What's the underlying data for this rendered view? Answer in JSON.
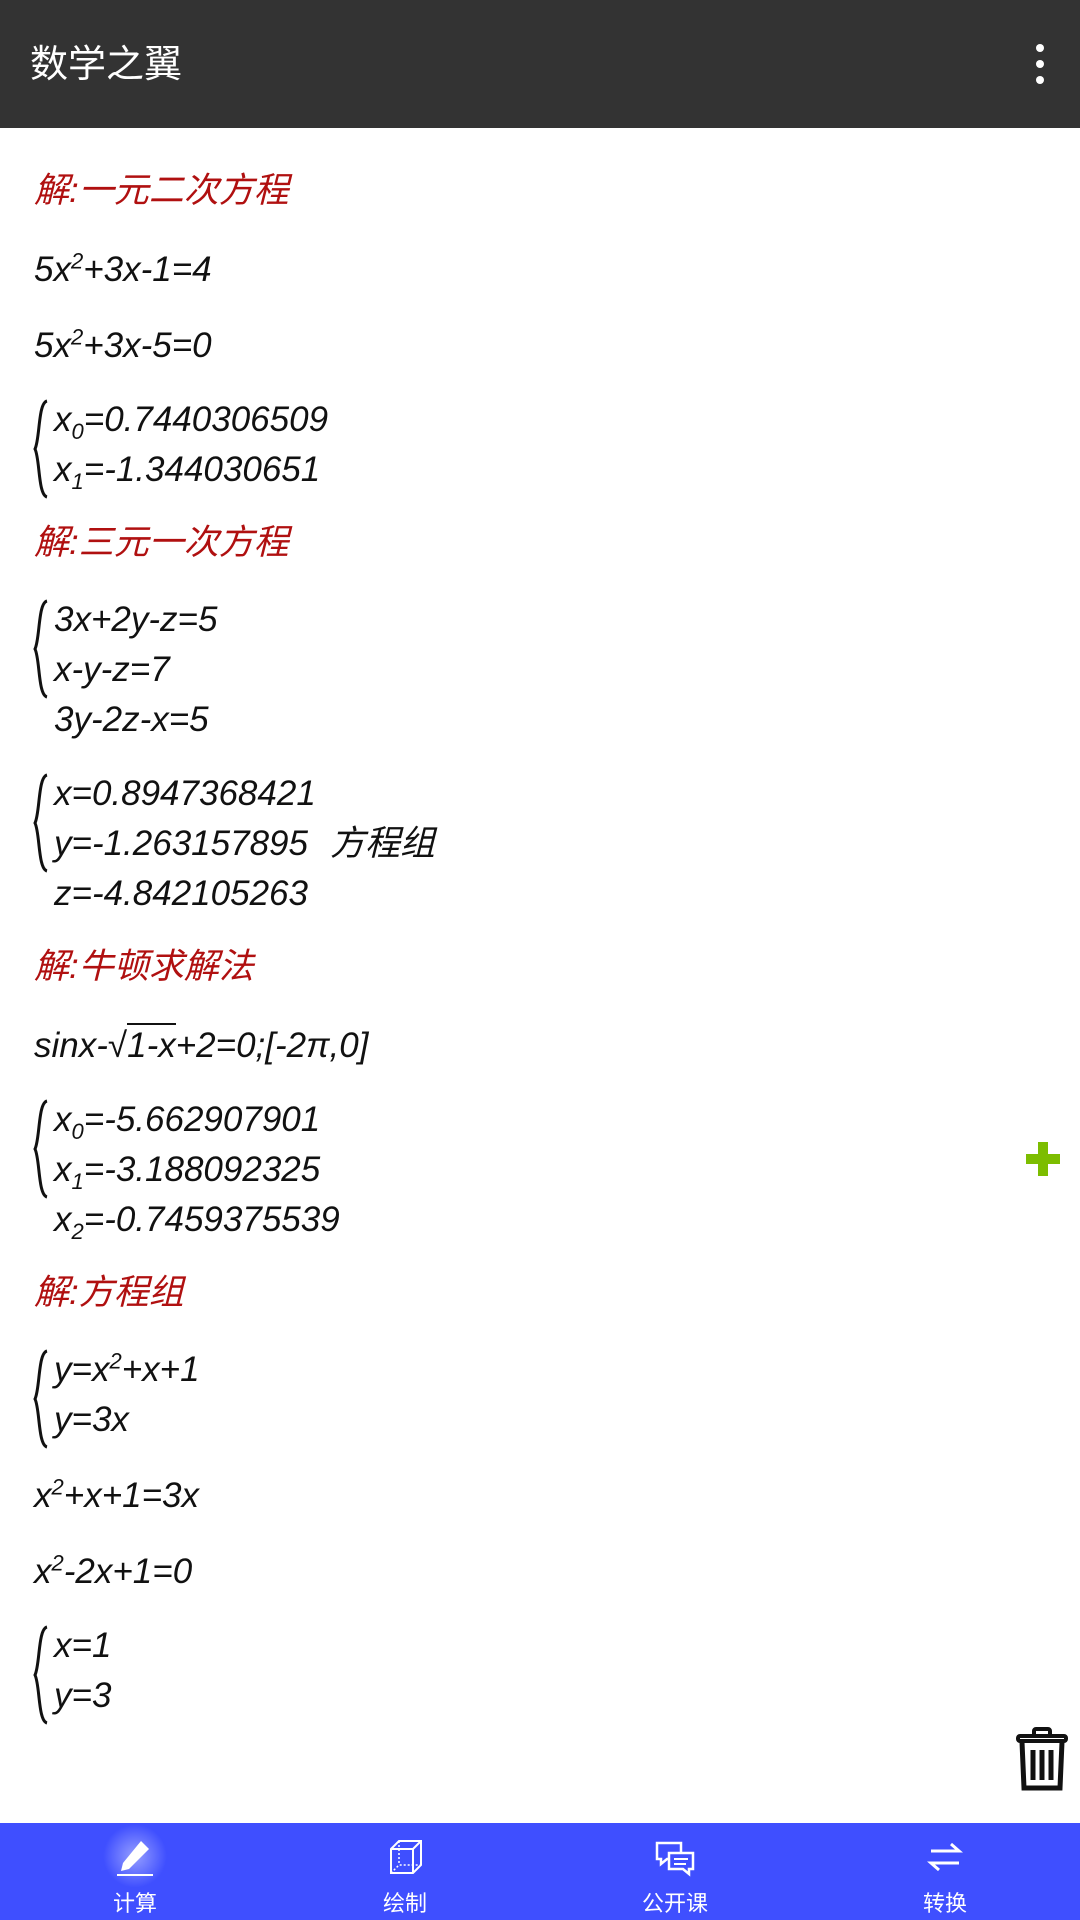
{
  "appbar": {
    "title": "数学之翼"
  },
  "sections": {
    "s1": {
      "title": "解:一元二次方程",
      "eq1": {
        "a": "5x",
        "exp": "2",
        "b": "+3x-1=4"
      },
      "eq2": {
        "a": "5x",
        "exp": "2",
        "b": "+3x-5=0"
      },
      "res": [
        {
          "v": "x",
          "sub": "0",
          "rest": "=0.7440306509"
        },
        {
          "v": "x",
          "sub": "1",
          "rest": "=-1.344030651"
        }
      ]
    },
    "s2": {
      "title": "解:三元一次方程",
      "sys": [
        "3x+2y-z=5",
        "x-y-z=7",
        "3y-2z-x=5"
      ],
      "res": [
        "x=0.8947368421",
        "y=-1.263157895",
        "z=-4.842105263"
      ],
      "note": "方程组"
    },
    "s3": {
      "title": "解:牛顿求解法",
      "eq": {
        "a": "sinx-√",
        "rad": "1-x",
        "b": "+2=0;[-2π,0]"
      },
      "res": [
        {
          "v": "x",
          "sub": "0",
          "rest": "=-5.662907901"
        },
        {
          "v": "x",
          "sub": "1",
          "rest": "=-3.188092325"
        },
        {
          "v": "x",
          "sub": "2",
          "rest": "=-0.7459375539"
        }
      ]
    },
    "s4": {
      "title": "解:方程组",
      "sys1": {
        "a": "y=x",
        "exp": "2",
        "b": "+x+1"
      },
      "sys2": "y=3x",
      "eq1": {
        "a": "x",
        "exp": "2",
        "b": "+x+1=3x"
      },
      "eq2": {
        "a": "x",
        "exp": "2",
        "b": "-2x+1=0"
      },
      "res": [
        "x=1",
        "y=3"
      ]
    }
  },
  "tabs": [
    {
      "label": "计算",
      "icon": "pencil-icon"
    },
    {
      "label": "绘制",
      "icon": "cube-icon"
    },
    {
      "label": "公开课",
      "icon": "chat-icon"
    },
    {
      "label": "转换",
      "icon": "swap-icon"
    }
  ],
  "colors": {
    "appbar": "#333333",
    "section_title": "#b01010",
    "bottombar": "#3f4fff",
    "plus": "#7cbd00"
  }
}
